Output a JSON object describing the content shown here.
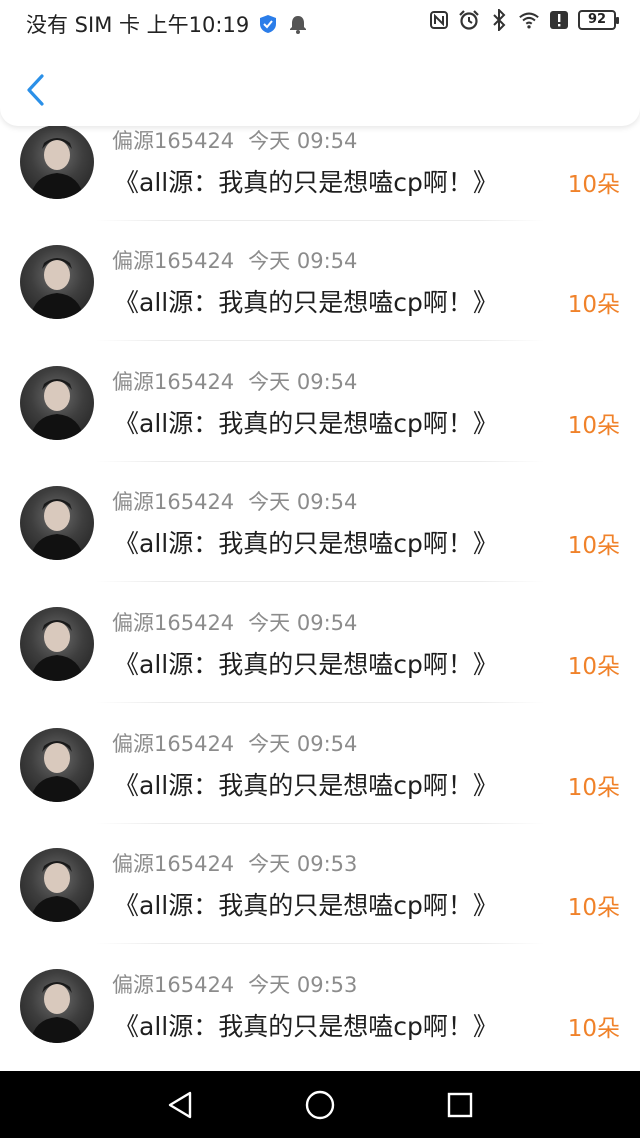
{
  "status_bar": {
    "left_text": "没有 SIM 卡 上午10:19",
    "battery": "92",
    "accent": "#2b7de9"
  },
  "header": {
    "back_icon": "chevron-left-icon",
    "accent": "#2b90e8"
  },
  "list": {
    "items": [
      {
        "user": "偏源165424",
        "time": "今天 09:54",
        "title": "《all源：我真的只是想嗑cp啊！》",
        "count": "10朵"
      },
      {
        "user": "偏源165424",
        "time": "今天 09:54",
        "title": "《all源：我真的只是想嗑cp啊！》",
        "count": "10朵"
      },
      {
        "user": "偏源165424",
        "time": "今天 09:54",
        "title": "《all源：我真的只是想嗑cp啊！》",
        "count": "10朵"
      },
      {
        "user": "偏源165424",
        "time": "今天 09:54",
        "title": "《all源：我真的只是想嗑cp啊！》",
        "count": "10朵"
      },
      {
        "user": "偏源165424",
        "time": "今天 09:54",
        "title": "《all源：我真的只是想嗑cp啊！》",
        "count": "10朵"
      },
      {
        "user": "偏源165424",
        "time": "今天 09:54",
        "title": "《all源：我真的只是想嗑cp啊！》",
        "count": "10朵"
      },
      {
        "user": "偏源165424",
        "time": "今天 09:53",
        "title": "《all源：我真的只是想嗑cp啊！》",
        "count": "10朵"
      },
      {
        "user": "偏源165424",
        "time": "今天 09:53",
        "title": "《all源：我真的只是想嗑cp啊！》",
        "count": "10朵"
      }
    ]
  },
  "colors": {
    "count": "#f0822a",
    "meta": "#8c8c8c"
  },
  "nav_bar": {
    "icons": [
      "back-triangle-icon",
      "home-circle-icon",
      "recents-square-icon"
    ]
  }
}
